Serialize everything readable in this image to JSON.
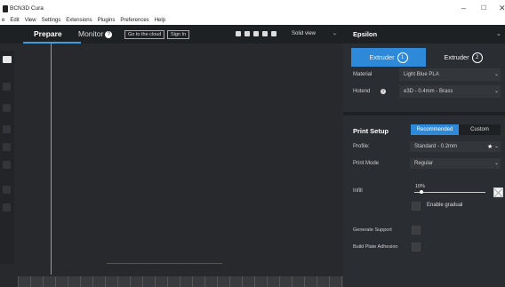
{
  "window": {
    "title": "BCN3D Cura",
    "controls": {
      "minimize": "–",
      "maximize": "☐",
      "close": "✕"
    }
  },
  "menu": [
    "e",
    "Edit",
    "View",
    "Settings",
    "Extensions",
    "Plugins",
    "Preferences",
    "Help"
  ],
  "header": {
    "tabs": {
      "prepare": "Prepare",
      "monitor": "Monitor"
    },
    "help_glyph": "?",
    "cloud_button": "Go to the cloud",
    "signin_button": "Sign In",
    "view_mode": "Solid view",
    "chevron": "⌄"
  },
  "panel": {
    "printer": "Epsilon",
    "extruders": [
      {
        "label": "Extruder",
        "number": "1"
      },
      {
        "label": "Extruder",
        "number": "2"
      }
    ],
    "material_label": "Material",
    "material_value": "Light Blue PLA",
    "hotend_label": "Hotend",
    "hotend_value": "e3D - 0.4mm - Brass",
    "info_glyph": "i",
    "setup": {
      "title": "Print Setup",
      "recommended": "Recommended",
      "custom": "Custom",
      "profile_label": "Profile:",
      "profile_value": "Standard - 0.2mm",
      "profile_star": "★",
      "print_mode_label": "Print Mode",
      "print_mode_value": "Regular",
      "infill_label": "Infill",
      "infill_value": "10%",
      "infill_fraction": 0.1,
      "gradual_label": "Enable gradual",
      "support_label": "Generate Support",
      "adhesion_label": "Build Plate Adhesion"
    }
  }
}
